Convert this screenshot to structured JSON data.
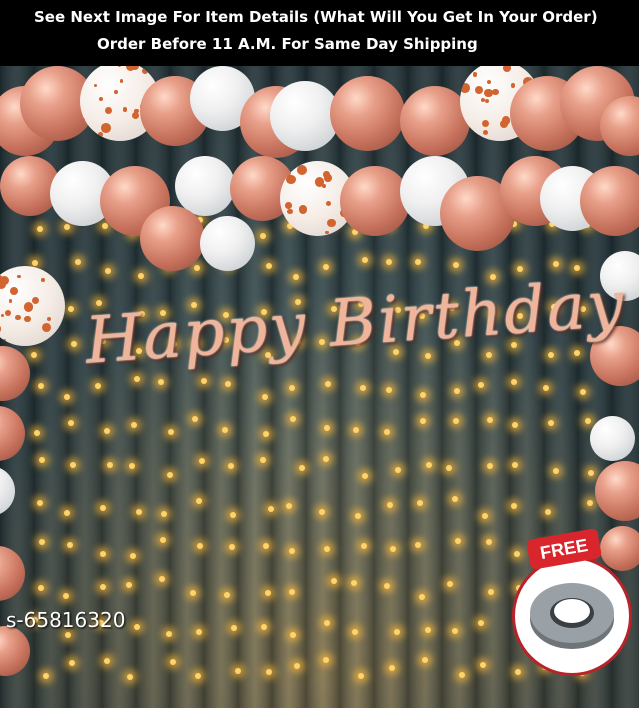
{
  "banner": {
    "line1": "See Next Image For Item Details (What Will You Get In Your Order)",
    "line2": "Order Before 11 A.M. For Same Day Shipping"
  },
  "decor": {
    "banner_text": "Happy Birthday",
    "free_label": "FREE"
  },
  "watermark": "s-65816320",
  "colors": {
    "rose_gold": "#c7725d",
    "balloon_white": "#f0f0f0",
    "fairy_light": "#ffd36a",
    "badge_red": "#d8262c"
  }
}
